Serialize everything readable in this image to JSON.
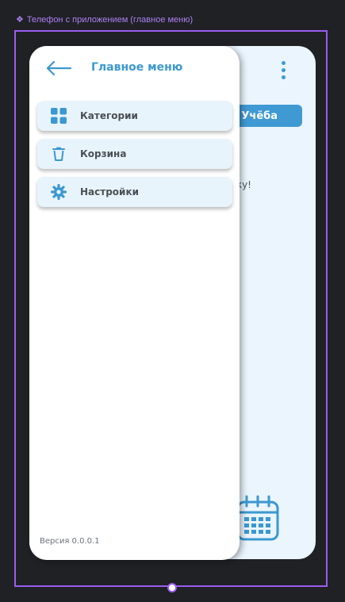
{
  "frame": {
    "label": "Телефон с приложением (главное меню)",
    "icon": "component-diamond-icon"
  },
  "background_screen": {
    "chip_label": "Учёба",
    "partial_text": "ку!",
    "menu_icon": "more-vertical-icon",
    "calendar_icon": "calendar-icon"
  },
  "drawer": {
    "back_icon": "arrow-left-icon",
    "title": "Главное меню",
    "items": [
      {
        "label": "Категории",
        "icon": "grid-icon"
      },
      {
        "label": "Корзина",
        "icon": "trash-icon"
      },
      {
        "label": "Настройки",
        "icon": "gear-icon"
      }
    ],
    "version": "Версия 0.0.0.1"
  },
  "colors": {
    "accent": "#3b98d0",
    "screen_bg": "#eaf5fd",
    "item_bg": "#e8f4fc",
    "canvas_bg": "#1f2125",
    "selection": "#9b5cf0"
  }
}
